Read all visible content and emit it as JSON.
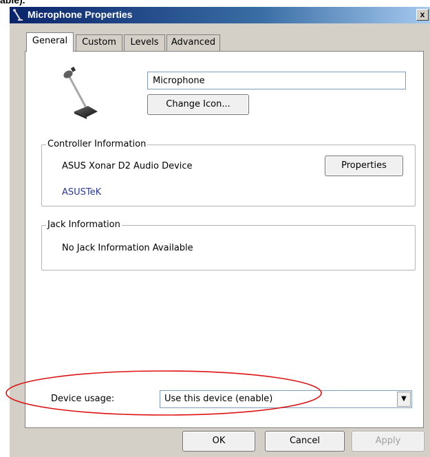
{
  "fragment_top": "able).",
  "window": {
    "title": "Microphone Properties",
    "close_label": "x"
  },
  "tabs": [
    {
      "label": "General",
      "active": true
    },
    {
      "label": "Custom",
      "active": false
    },
    {
      "label": "Levels",
      "active": false
    },
    {
      "label": "Advanced",
      "active": false
    }
  ],
  "general": {
    "device_name_value": "Microphone",
    "change_icon_label": "Change Icon...",
    "controller_info": {
      "title": "Controller Information",
      "device": "ASUS Xonar D2 Audio Device",
      "vendor": "ASUSTeK",
      "properties_label": "Properties"
    },
    "jack_info": {
      "title": "Jack Information",
      "message": "No Jack Information Available"
    },
    "device_usage": {
      "label": "Device usage:",
      "selected": "Use this device (enable)"
    }
  },
  "buttons": {
    "ok": "OK",
    "cancel": "Cancel",
    "apply": "Apply"
  },
  "annotation": {
    "ellipse_color": "#e01010"
  }
}
